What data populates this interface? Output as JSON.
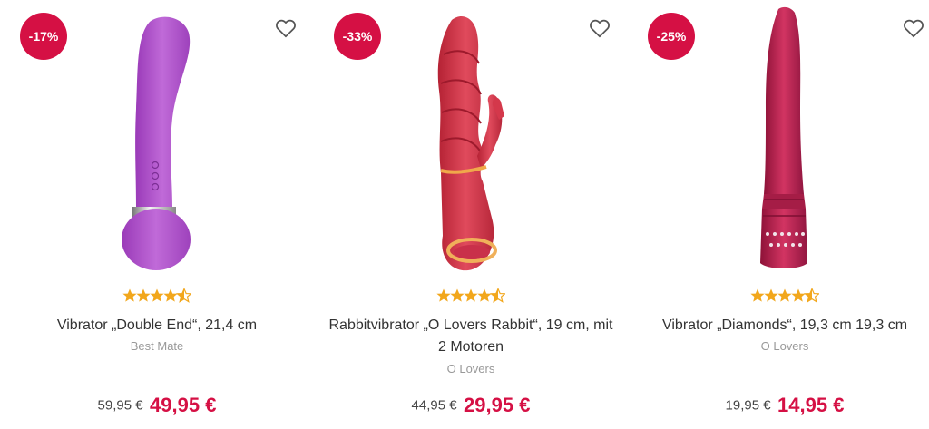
{
  "products": [
    {
      "discount": "-17%",
      "title": "Vibrator „Double End“, 21,4 cm",
      "brand": "Best Mate",
      "old_price": "59,95 €",
      "price": "49,95 €",
      "rating": 4.5,
      "color": "#b458cf"
    },
    {
      "discount": "-33%",
      "title": "Rabbitvibrator „O Lovers Rabbit“, 19 cm, mit 2 Motoren",
      "brand": "O Lovers",
      "old_price": "44,95 €",
      "price": "29,95 €",
      "rating": 4.5,
      "color": "#d2394e"
    },
    {
      "discount": "-25%",
      "title": "Vibrator „Diamonds“, 19,3 cm 19,3 cm",
      "brand": "O Lovers",
      "old_price": "19,95 €",
      "price": "14,95 €",
      "rating": 4.5,
      "color": "#bd1f4e"
    }
  ],
  "colors": {
    "accent": "#d51044",
    "star": "#f2a71c"
  },
  "icons": {
    "wishlist": "heart-outline-icon",
    "rating": "star-icon"
  }
}
